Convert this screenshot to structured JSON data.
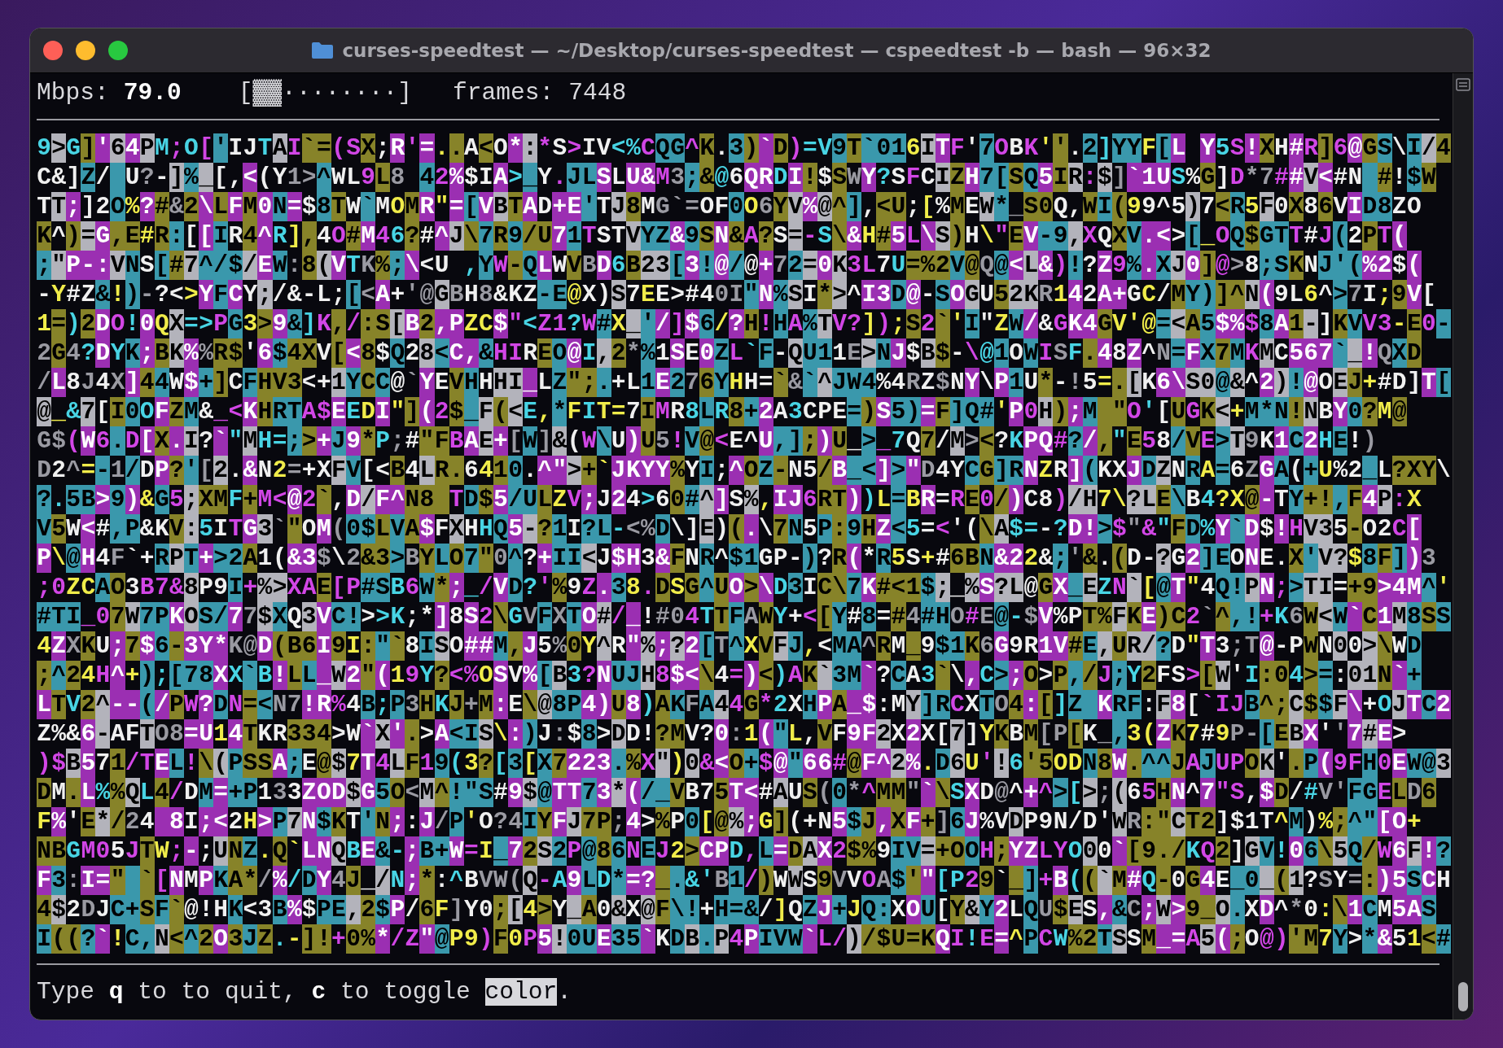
{
  "window": {
    "title": "curses-speedtest — ~/Desktop/curses-speedtest — cspeedtest -b — bash — 96×32"
  },
  "header": {
    "mbps_label": "Mbps:",
    "mbps_value": "79.0",
    "meter": "[▓▓········]",
    "frames_label": "frames:",
    "frames_value": "7448"
  },
  "lines": [
    "9>G]'64PM;O['IJTAI`=(SX;R'=..A<O*:*S>IV<%CQG^K.3)`D)=V9T`016ITF'7OBK''.2]YYF[L Y5S!XH#R]6@GS\\I/4",
    "C&]Z/ U?-]%_[,<(Y1>^WL9L8 42%$IA>_Y.JLSLU&M3;&@6QRDI!$SWY?SFCIZH7[SQ5IR:$]`1US%G]D*7##V<#N #!$W",
    "TT;]2O%?#&2\\LFM0N=$8TW`MOMR\"=[VBTAD+E'TJ8MG`=OF0O6YV%@^],<U;[%MEW*_S0Q,WI(99^5)7<R5F0X86VID8ZO",
    "K^)=G,E#R:[[IR4^R],4O#M46?#^J\\7R9/U71TSTVYZ&9SN&A?S=-S\\&H#5L\\S)H\\\"EV-9,XQXV.<>[_OQ$GTT#J(2PT(",
    ";\"P-:VNS[#7^/$/EW:8(VTK%;\\<U ,YW-QLWVBD6B23[3!@/@+72=0K3L7U=%2V@Q@<L&)!?Z9%.XJ0]@>8;SKNJ'(%2$(",
    "-Y#Z&!)-?<>YFCY;/&-L;[<A+'@GBH8&KZ-E@X)S7EE>#40I\"N%SI*>^I3D@-SOGU52KR142A+GC/MY)]^N(9L6^>7I;9V[",
    "1=)2DO!0QX=>PG3>9&]K,/:S[B2,PZC$\"<Z1?W#X_'/]$6/?H!HA%TV?]);S2`'I\"ZW/&GK4GV'@=<A5$%$8A1-]KVV3-E0-",
    "2G4?DYK;BK%%R$'6$4XV[<8$Q28<C,&HIREO@I,2*%1SE0ZL`F-QU11E>NJ$B$-\\@1OWISF.48Z^N=FX7MKMC567`_!QXD",
    "/L8J4X]44W$+]CFHV3<+1YCC@`YEVHHHI_LZ\";.+L1E276YHH=`&`^JW4%4RZ$NY\\P1U*-!5=.[K6\\S0@&^2)!@OEJ+#D]T[",
    "@_&7[I0OFZM&_<KHRTA$EEDI\"](2$_F(<E,*FIT=7IMR8LR8+2A3CPE=)S5)=F]Q#'P0H);M \"O'[UGK<+M*N!NBY0?M@",
    "G$(W6.D[X.I?`\"MH=;>+J9*P;#\"FBAE+[W]&(W\\U)U5!V@<E^U,];)U_>_7Q7/M><?KPQ#?/,\"E58/VE>T9K1C2HE!)",
    "D2^=-1/DP?'[2.&N2=+XFV[<B4LR.6410.^\">+`JKYY%YI;^OZ-N5/B_<]>\"D4YCG]RNZR](KXJDZNRA=6ZGA(+U%2_L?XY\\",
    "?.5B>9)&G5;XMF+M<@2`,D/F^N8 TD$5/ULZV;J24>60#^]S%,IJ6RT))L=BR=RE0/)C8)/H7\\?LE\\B4?X@-TY+!,F4P:X",
    "V5W<#,P&KV:5ITG3`\"OM(0$LVA$FXHHQ5-?1I?L-<%D\\]E)(.\\7N5P:9HZ<5=<'(\\A$=-?D!>$\"&\"FD%Y`D$!HV35-O2C[",
    "P\\@H4F`+RPT+>2A1(&3$\\2&3>BYLO7\"0^?+II<J$H3&FNR^$1GP-)?R(*R5S+#6BN&22&;'&.(D-?G2]EONE.X'V?$8F])3",
    ";0ZCAO3B7&8P9I+%>XAE[P#SB6W*;_/VD?'%9Z.38.DSG^UO>\\D3IC\\7K#<1$;_%S?L@GX_EZN`[@T\"4Q!PN;>TI=+9>4M^'",
    "#TI_07W7PKOS/77$XQ3VC!>>K;*]8S2\\GVFXTO#/_!#04TTFAWY+<[Y#8=#4#HO#E@-$V%PT%FKE)C2`^,!+K6W<W`C1M8SS",
    "4ZXKU;7$6-3Y*K@D(B6I9I:\"`8ISO##M,J5%0Y^R\"%;?2[T^XVFJ,<MA^RM_9$1K6G9R1V#E,UR/?D\"T3;T@-PWN00>\\WD",
    ";^24H^+);[78XX`B!LL_W2\"(19Y?<%OSV%[B3?NUJH8$<\\4=)<)AK`3M`?CA3`\\,C>;O>P,/J;Y2FS>[W'I:04>=:01N`+",
    "LTV2^--(/PW?DN=<N7!R%4B;P3HKJ+M:E\\@8P4)U8)AKFA44G*2XHPA_$:MY]RCXTO4:[]Z KRF:F8[`IJB^;C$$F\\+OJTC2",
    "Z%&6-AFTO8=U14TKR334>W`X'.>A<IS\\:)J:$8>DD!?MV?0:1(\"L,VF9F2X2X[7]YKBM[P[K_,3(ZK7#9P-[EBX''7#E>",
    ")$B571/TEL!\\(PSSA;E@$7T4LF19(3?[3[X7223.%X\")0&<O+$@\"66#@F^2%.D6U'!6'5ODN8W.^^JAJUPOK'.P(9FH0EW@3",
    "DM.L%%QL4/DM=+P133ZOD$G5O<M^!\"S#9$@TT73*(/_VB75T<#AUS(0*^MM\"`\\SXD@^+^>[>;(65HN^7\"S,$D/#V'FGELD6",
    "F%'E*/24 8I;<2H>P7N$KT'N;:J/P'O?4IYFJ7P;4>%P0[@%;G](+N5$J,XF+]6J%VDP9N/D'WR:\"CT2]$1T^M)%;^\"[O+",
    "NBGM05JTW;-;UNZ.Q`LNQBE&-;B+W=I_72S2P@86NEJ2>CPD,L=DAX2$%9IV=+OOH;YZLYO00`[9./KQ2]GV!06\\5Q/W6F!?",
    "F3:I=\" `[NMPKA*/%/DY4J_/N;*:^BVW(Q-A9LD*=?_.&'B1/)WWS9VVOA$'\"[P29`_]+B((`M#Q-0G4E_0_(1?SY=:)5SCH",
    "4$2DJC+SF`@!HK<3B%$PE,2$P/6F]Y0;[4>Y_A0&X@F\\!+H=&/]QZJ+JQ:XOU[Y&Y2LQU$ES,&C;W>9_O.XD^*0:\\1CM5AS",
    "I((?`!C,N<^2O3JZ.-]!+0%*/Z\"@P9)F0P5!0UE35`KDB.P4PIVW`L/)/$U=KQI!E=^PCW%2TSSM_=A5(;O@)'M7Y>*&51<#"
  ],
  "footer": {
    "before": "Type **q** to to quit, **c** to toggle ",
    "highlight": "color",
    "after": "."
  }
}
